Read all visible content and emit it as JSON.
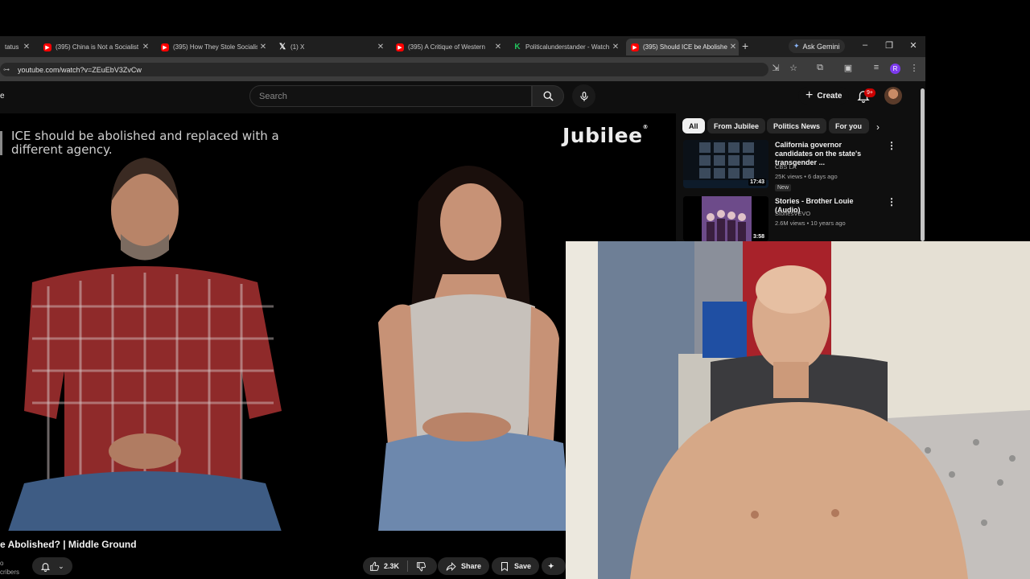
{
  "browser": {
    "tabs": [
      {
        "title": "tatus",
        "favicon": "generic",
        "active": false
      },
      {
        "title": "(395) China is Not a Socialist",
        "favicon": "youtube",
        "active": false
      },
      {
        "title": "(395) How They Stole Socialism",
        "favicon": "youtube",
        "active": false
      },
      {
        "title": "(1) X",
        "favicon": "x",
        "active": false
      },
      {
        "title": "(395) A Critique of Western",
        "favicon": "youtube",
        "active": false
      },
      {
        "title": "Politicalunderstander - Watch",
        "favicon": "kick",
        "active": false
      },
      {
        "title": "(395) Should ICE be Abolished",
        "favicon": "youtube",
        "active": true
      }
    ],
    "new_tab_icon": "plus-icon",
    "gemini_label": "Ask Gemini",
    "url": "youtube.com/watch?v=ZEuEbV3ZvCw",
    "profile_initial": "R"
  },
  "youtube": {
    "search_placeholder": "Search",
    "create_label": "Create",
    "notification_count": "9+"
  },
  "video": {
    "caption": "ICE should be abolished and replaced with a different agency.",
    "watermark": "Jubilee",
    "title": "e Abolished? | Middle Ground",
    "subscribers_fragment": "cribers",
    "like_count": "2.3K",
    "share_label": "Share",
    "save_label": "Save"
  },
  "sidebar": {
    "chips": [
      "All",
      "From Jubilee",
      "Politics News",
      "For you"
    ],
    "recommendations": [
      {
        "title": "California governor candidates on the state's transgender ...",
        "channel": "CBS LA",
        "meta": "25K views • 6 days ago",
        "badge": "New",
        "duration": "17:43"
      },
      {
        "title": "Stories - Brother Louie (Audio)",
        "channel": "StoriesVEVO",
        "meta": "2.6M views • 10 years ago",
        "badge": "",
        "duration": "3:58"
      }
    ]
  },
  "colors": {
    "youtube_bg": "#0f0f0f",
    "accent_red": "#ff0000",
    "chip_bg": "#272727"
  }
}
